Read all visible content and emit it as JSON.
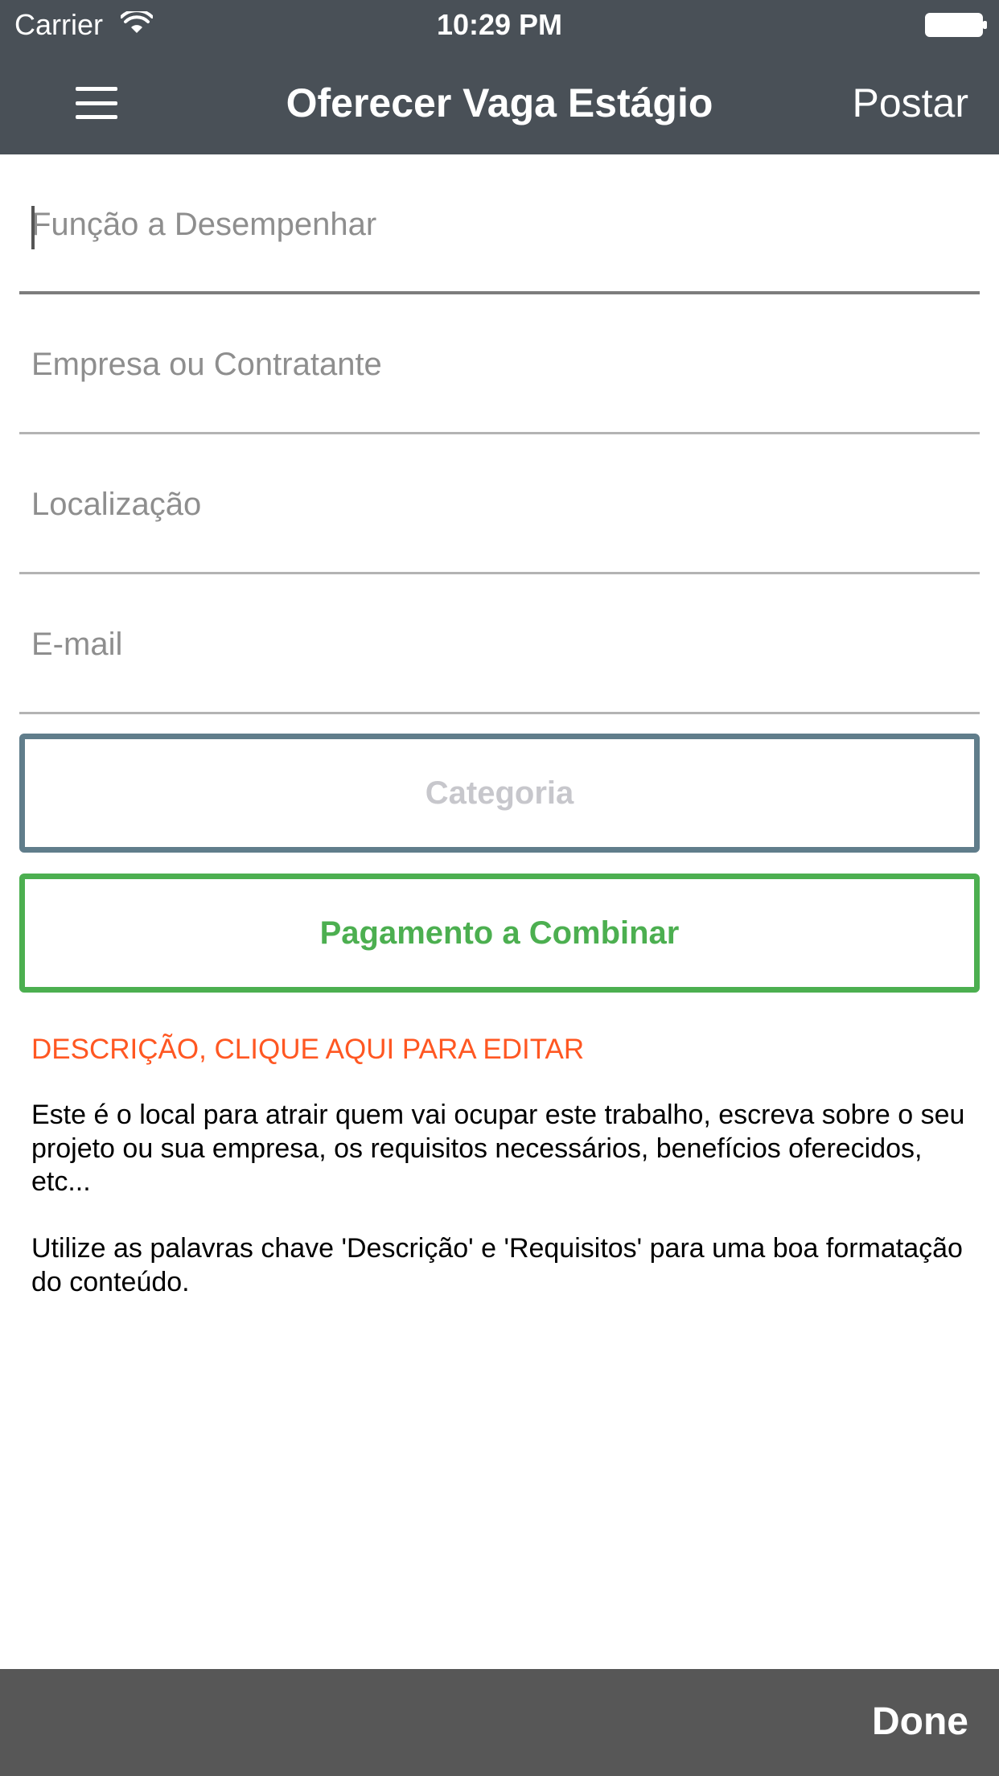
{
  "status_bar": {
    "carrier": "Carrier",
    "time": "10:29 PM"
  },
  "nav": {
    "title": "Oferecer Vaga Estágio",
    "post_label": "Postar",
    "menu_icon": "hamburger-menu-icon"
  },
  "form": {
    "role_placeholder": "Função a Desempenhar",
    "company_placeholder": "Empresa ou Contratante",
    "location_placeholder": "Localização",
    "email_placeholder": "E-mail",
    "category_label": "Categoria",
    "payment_label": "Pagamento a Combinar"
  },
  "description": {
    "heading": "DESCRIÇÃO, CLIQUE AQUI PARA EDITAR",
    "paragraph1": "Este é o local para atrair quem vai ocupar este trabalho, escreva sobre o seu projeto ou sua empresa, os requisitos necessários, benefícios oferecidos, etc...",
    "paragraph2": "Utilize as palavras chave 'Descrição' e 'Requisitos' para uma boa formatação do conteúdo."
  },
  "keyboard_toolbar": {
    "done_label": "Done"
  },
  "colors": {
    "header_bg": "#495057",
    "category_border": "#607d8b",
    "payment_accent": "#4caf50",
    "heading_accent": "#ff5722",
    "toolbar_bg": "#575757"
  }
}
